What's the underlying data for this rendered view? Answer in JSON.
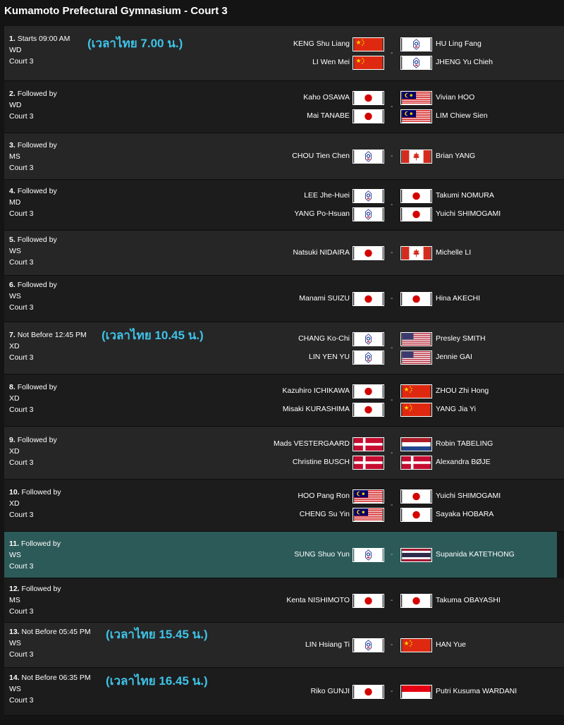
{
  "page": {
    "title": "Kumamoto Prefectural Gymnasium - Court 3"
  },
  "matches": [
    {
      "num": "1.",
      "time": "Starts 09:00 AM",
      "event": "WD",
      "court": "Court 3",
      "thai": "(เวลาไทย  7.00  น.)",
      "left": [
        {
          "name": "KENG Shu Liang",
          "flag": "china-flag"
        },
        {
          "name": "LI Wen Mei",
          "flag": "china-flag"
        }
      ],
      "right": [
        {
          "name": "HU Ling Fang",
          "flag": "chinese-taipei-flag"
        },
        {
          "name": "JHENG Yu Chieh",
          "flag": "chinese-taipei-flag"
        }
      ]
    },
    {
      "num": "2.",
      "time": "Followed by",
      "event": "WD",
      "court": "Court 3",
      "thai": "",
      "left": [
        {
          "name": "Kaho OSAWA",
          "flag": "japan-flag"
        },
        {
          "name": "Mai TANABE",
          "flag": "japan-flag"
        }
      ],
      "right": [
        {
          "name": "Vivian HOO",
          "flag": "malaysia-flag"
        },
        {
          "name": "LIM Chiew Sien",
          "flag": "malaysia-flag"
        }
      ]
    },
    {
      "num": "3.",
      "time": "Followed by",
      "event": "MS",
      "court": "Court 3",
      "thai": "",
      "left": [
        {
          "name": "CHOU Tien Chen",
          "flag": "chinese-taipei-flag"
        }
      ],
      "right": [
        {
          "name": "Brian YANG",
          "flag": "canada-flag"
        }
      ]
    },
    {
      "num": "4.",
      "time": "Followed by",
      "event": "MD",
      "court": "Court 3",
      "thai": "",
      "left": [
        {
          "name": "LEE Jhe-Huei",
          "flag": "chinese-taipei-flag"
        },
        {
          "name": "YANG Po-Hsuan",
          "flag": "chinese-taipei-flag"
        }
      ],
      "right": [
        {
          "name": "Takumi NOMURA",
          "flag": "japan-flag"
        },
        {
          "name": "Yuichi SHIMOGAMI",
          "flag": "japan-flag"
        }
      ]
    },
    {
      "num": "5.",
      "time": "Followed by",
      "event": "WS",
      "court": "Court 3",
      "thai": "",
      "left": [
        {
          "name": "Natsuki NIDAIRA",
          "flag": "japan-flag"
        }
      ],
      "right": [
        {
          "name": "Michelle LI",
          "flag": "canada-flag"
        }
      ]
    },
    {
      "num": "6.",
      "time": "Followed by",
      "event": "WS",
      "court": "Court 3",
      "thai": "",
      "left": [
        {
          "name": "Manami SUIZU",
          "flag": "japan-flag"
        }
      ],
      "right": [
        {
          "name": "Hina AKECHI",
          "flag": "japan-flag"
        }
      ]
    },
    {
      "num": "7.",
      "time": "Not Before 12:45 PM",
      "event": "XD",
      "court": "Court 3",
      "thai": "(เวลาไทย  10.45  น.)",
      "left": [
        {
          "name": "CHANG Ko-Chi",
          "flag": "chinese-taipei-flag"
        },
        {
          "name": "LIN YEN YU",
          "flag": "chinese-taipei-flag"
        }
      ],
      "right": [
        {
          "name": "Presley SMITH",
          "flag": "usa-flag"
        },
        {
          "name": "Jennie GAI",
          "flag": "usa-flag"
        }
      ]
    },
    {
      "num": "8.",
      "time": "Followed by",
      "event": "XD",
      "court": "Court 3",
      "thai": "",
      "left": [
        {
          "name": "Kazuhiro ICHIKAWA",
          "flag": "japan-flag"
        },
        {
          "name": "Misaki KURASHIMA",
          "flag": "japan-flag"
        }
      ],
      "right": [
        {
          "name": "ZHOU Zhi Hong",
          "flag": "china-flag"
        },
        {
          "name": "YANG Jia Yi",
          "flag": "china-flag"
        }
      ]
    },
    {
      "num": "9.",
      "time": "Followed by",
      "event": "XD",
      "court": "Court 3",
      "thai": "",
      "left": [
        {
          "name": "Mads VESTERGAARD",
          "flag": "denmark-flag"
        },
        {
          "name": "Christine BUSCH",
          "flag": "denmark-flag"
        }
      ],
      "right": [
        {
          "name": "Robin TABELING",
          "flag": "netherlands-flag"
        },
        {
          "name": "Alexandra BØJE",
          "flag": "denmark-flag"
        }
      ]
    },
    {
      "num": "10.",
      "time": "Followed by",
      "event": "XD",
      "court": "Court 3",
      "thai": "",
      "left": [
        {
          "name": "HOO Pang Ron",
          "flag": "malaysia-flag"
        },
        {
          "name": "CHENG Su Yin",
          "flag": "malaysia-flag"
        }
      ],
      "right": [
        {
          "name": "Yuichi SHIMOGAMI",
          "flag": "japan-flag"
        },
        {
          "name": "Sayaka HOBARA",
          "flag": "japan-flag"
        }
      ]
    },
    {
      "num": "11.",
      "time": "Followed by",
      "event": "WS",
      "court": "Court 3",
      "thai": "",
      "highlight": true,
      "left": [
        {
          "name": "SUNG Shuo Yun",
          "flag": "chinese-taipei-flag"
        }
      ],
      "right": [
        {
          "name": "Supanida KATETHONG",
          "flag": "thailand-flag"
        }
      ]
    },
    {
      "num": "12.",
      "time": "Followed by",
      "event": "MS",
      "court": "Court 3",
      "thai": "",
      "left": [
        {
          "name": "Kenta NISHIMOTO",
          "flag": "japan-flag"
        }
      ],
      "right": [
        {
          "name": "Takuma OBAYASHI",
          "flag": "japan-flag"
        }
      ]
    },
    {
      "num": "13.",
      "time": "Not Before 05:45 PM",
      "event": "WS",
      "court": "Court 3",
      "thai": "(เวลาไทย  15.45  น.)",
      "left": [
        {
          "name": "LIN Hsiang Ti",
          "flag": "chinese-taipei-flag"
        }
      ],
      "right": [
        {
          "name": "HAN Yue",
          "flag": "china-flag"
        }
      ]
    },
    {
      "num": "14.",
      "time": "Not Before 06:35 PM",
      "event": "WS",
      "court": "Court 3",
      "thai": "(เวลาไทย  16.45  น.)",
      "left": [
        {
          "name": "Riko GUNJI",
          "flag": "japan-flag"
        }
      ],
      "right": [
        {
          "name": "Putri Kusuma WARDANI",
          "flag": "indonesia-flag"
        }
      ]
    }
  ],
  "separator": "-"
}
